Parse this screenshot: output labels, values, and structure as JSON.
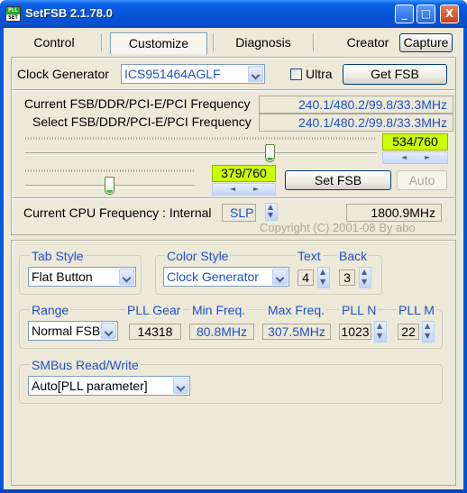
{
  "window": {
    "title": "SetFSB  2.1.78.0",
    "icon_text_top": "PLL",
    "icon_text_bottom": "SET",
    "minimize_symbol": "_",
    "maximize_symbol": "□",
    "close_symbol": "X"
  },
  "tabs": {
    "items": [
      {
        "label": "Control"
      },
      {
        "label": "Customize",
        "selected": true
      },
      {
        "label": "Diagnosis"
      },
      {
        "label": "Creator"
      }
    ],
    "capture_label": "Capture"
  },
  "clock": {
    "label": "Clock Generator",
    "value": "ICS951464AGLF",
    "ultra_label": "Ultra",
    "ultra_checked": false,
    "get_fsb_label": "Get FSB"
  },
  "freq": {
    "current_label": "Current FSB/DDR/PCI-E/PCI Frequency",
    "current_value": "240.1/480.2/99.8/33.3MHz",
    "select_label": "Select FSB/DDR/PCI-E/PCI Frequency",
    "select_value": "240.1/480.2/99.8/33.3MHz"
  },
  "sliders": {
    "slider1": {
      "value_text": "534/760",
      "position": 534,
      "max": 760
    },
    "slider2": {
      "value_text": "379/760",
      "position": 379,
      "max": 760
    },
    "spin_left": "◄",
    "spin_right": "►",
    "set_fsb_label": "Set FSB",
    "auto_label": "Auto"
  },
  "cpu": {
    "label": "Current CPU Frequency : Internal",
    "mode": "SLP",
    "value": "1800.9MHz",
    "copyright": "Copyright (C) 2001-08 By abo"
  },
  "customize": {
    "tab_style_label": "Tab Style",
    "tab_style_value": "Flat Button",
    "color_style_label": "Color Style",
    "color_style_value": "Clock Generator",
    "text_label": "Text",
    "text_value": "4",
    "back_label": "Back",
    "back_value": "3",
    "range_label": "Range",
    "range_value": "Normal FSB",
    "pll_gear_label": "PLL Gear",
    "pll_gear_value": "14318",
    "min_freq_label": "Min Freq.",
    "min_freq_value": "80.8MHz",
    "max_freq_label": "Max Freq.",
    "max_freq_value": "307.5MHz",
    "pll_n_label": "PLL N",
    "pll_n_value": "1023",
    "pll_m_label": "PLL M",
    "pll_m_value": "22",
    "smbus_label": "SMBus Read/Write",
    "smbus_value": "Auto[PLL parameter]",
    "spin_up": "▲",
    "spin_down": "▼"
  }
}
